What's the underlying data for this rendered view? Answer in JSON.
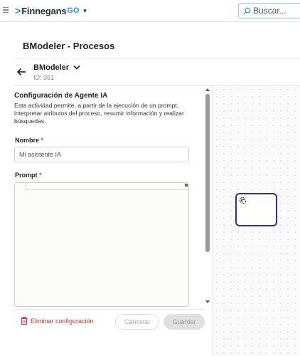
{
  "header": {
    "logo_text": "Finnegans",
    "logo_suffix": "GO",
    "search_placeholder": "Buscar..."
  },
  "page": {
    "title": "BModeler - Procesos"
  },
  "model": {
    "name": "BModeler",
    "id_label": "ID: 351"
  },
  "panel": {
    "title": "Configuración de Agente IA",
    "description": "Esta actividad permite, a partir de la ejecución de un prompt, interpretar atributos del proceso, resumir información y realizar búsquedas.",
    "name_label": "Nombre",
    "name_value": "Mi asistente IA",
    "prompt_label": "Prompt",
    "prompt_value": "",
    "required_mark": "*"
  },
  "footer": {
    "delete_label": "Eliminar configuración",
    "cancel_label": "Cancelar",
    "save_label": "Guardar"
  },
  "colors": {
    "brand_blue": "#1e9ad6",
    "task_border": "#2d2f9a",
    "danger": "#d32f2f"
  }
}
